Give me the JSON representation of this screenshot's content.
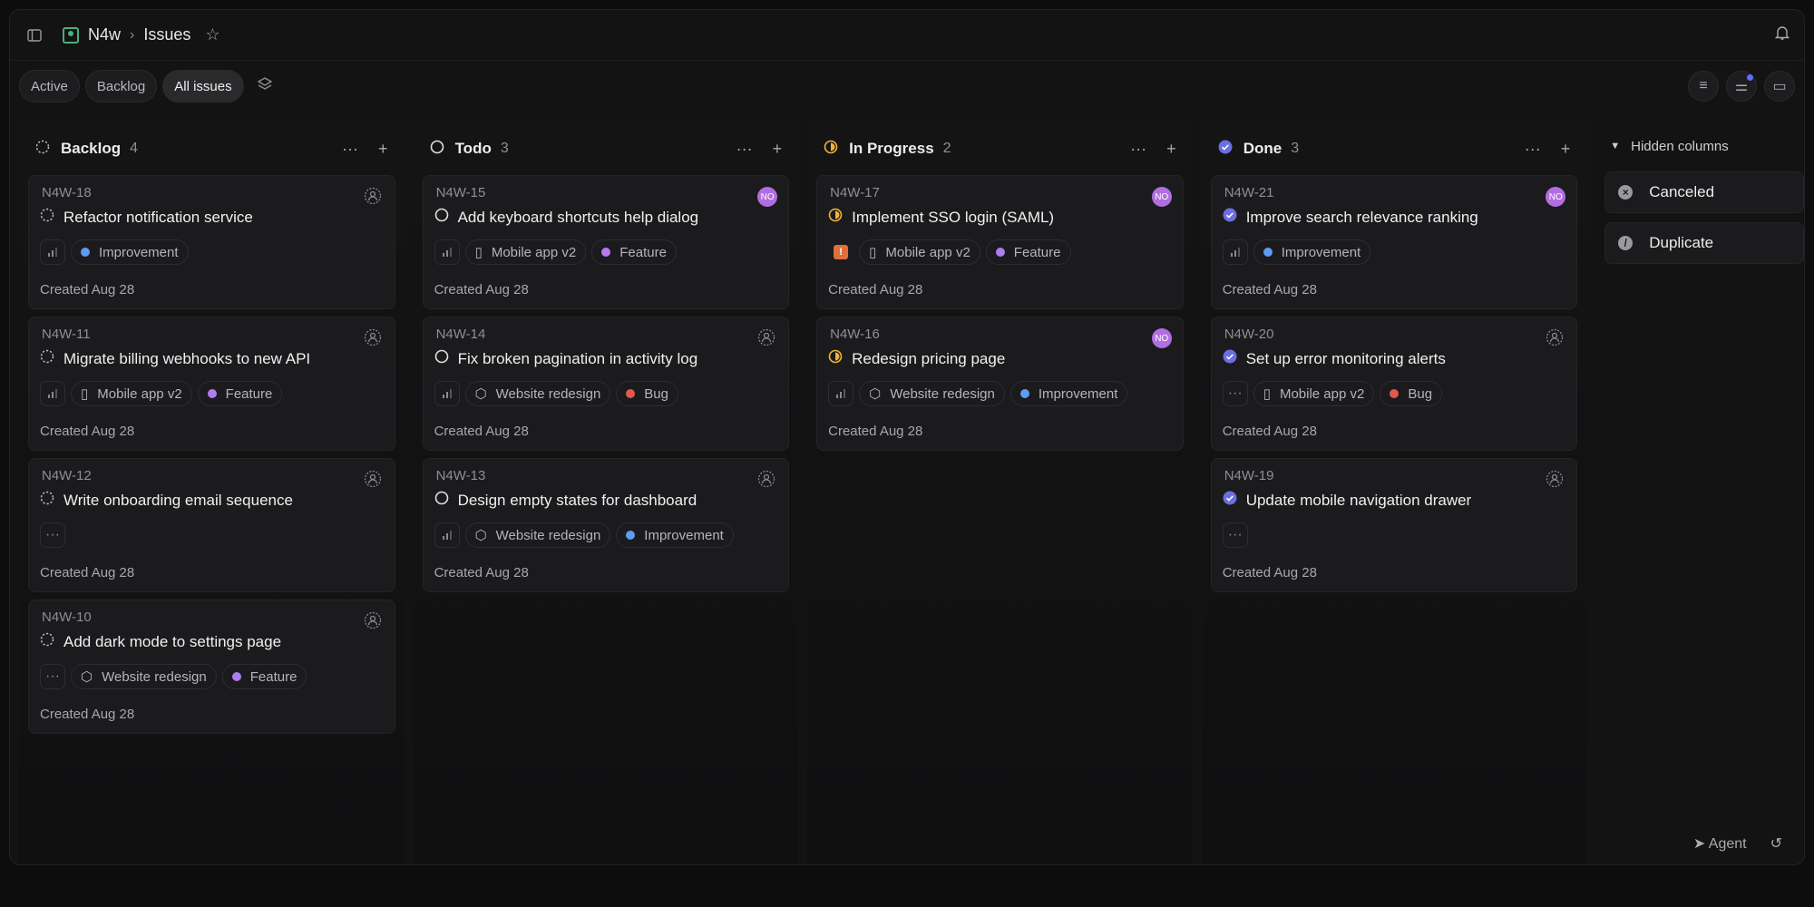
{
  "breadcrumb": {
    "project": "N4w",
    "page": "Issues"
  },
  "views": [
    "Active",
    "Backlog",
    "All issues"
  ],
  "columns": [
    {
      "title": "Backlog",
      "count": "4",
      "cards": [
        {
          "id": "N4W-18",
          "title": "Refactor notification service",
          "chips": [
            "Improvement"
          ],
          "created": "Created Aug 28"
        },
        {
          "id": "N4W-11",
          "title": "Migrate billing webhooks to new API",
          "chips": [
            "Mobile app v2",
            "Feature"
          ],
          "created": "Created Aug 28"
        },
        {
          "id": "N4W-12",
          "title": "Write onboarding email sequence",
          "chips": [],
          "created": "Created Aug 28"
        },
        {
          "id": "N4W-10",
          "title": "Add dark mode to settings page",
          "chips": [
            "Website redesign",
            "Feature"
          ],
          "created": "Created Aug 28"
        }
      ]
    },
    {
      "title": "Todo",
      "count": "3",
      "cards": [
        {
          "id": "N4W-15",
          "title": "Add keyboard shortcuts help dialog",
          "chips": [
            "Mobile app v2",
            "Feature"
          ],
          "created": "Created Aug 28",
          "avatar": "NO"
        },
        {
          "id": "N4W-14",
          "title": "Fix broken pagination in activity log",
          "chips": [
            "Website redesign",
            "Bug"
          ],
          "created": "Created Aug 28"
        },
        {
          "id": "N4W-13",
          "title": "Design empty states for dashboard",
          "chips": [
            "Website redesign",
            "Improvement"
          ],
          "created": "Created Aug 28"
        }
      ]
    },
    {
      "title": "In Progress",
      "count": "2",
      "cards": [
        {
          "id": "N4W-17",
          "title": "Implement SSO login (SAML)",
          "chips": [
            "Mobile app v2",
            "Feature"
          ],
          "created": "Created Aug 28",
          "avatar": "NO"
        },
        {
          "id": "N4W-16",
          "title": "Redesign pricing page",
          "chips": [
            "Website redesign",
            "Improvement"
          ],
          "created": "Created Aug 28",
          "avatar": "NO"
        }
      ]
    },
    {
      "title": "Done",
      "count": "3",
      "cards": [
        {
          "id": "N4W-21",
          "title": "Improve search relevance ranking",
          "chips": [
            "Improvement"
          ],
          "created": "Created Aug 28",
          "avatar": "NO"
        },
        {
          "id": "N4W-20",
          "title": "Set up error monitoring alerts",
          "chips": [
            "Mobile app v2",
            "Bug"
          ],
          "created": "Created Aug 28"
        },
        {
          "id": "N4W-19",
          "title": "Update mobile navigation drawer",
          "chips": [],
          "created": "Created Aug 28"
        }
      ]
    }
  ],
  "hidden": {
    "label": "Hidden columns",
    "items": [
      "Canceled",
      "Duplicate"
    ]
  },
  "footer": {
    "agent": "Agent"
  },
  "colors": {
    "feature": "#b07cf0",
    "improvement": "#5d9cf0",
    "bug": "#e0584f",
    "inprogress": "#f0b43a",
    "done": "#6b6fe0"
  }
}
